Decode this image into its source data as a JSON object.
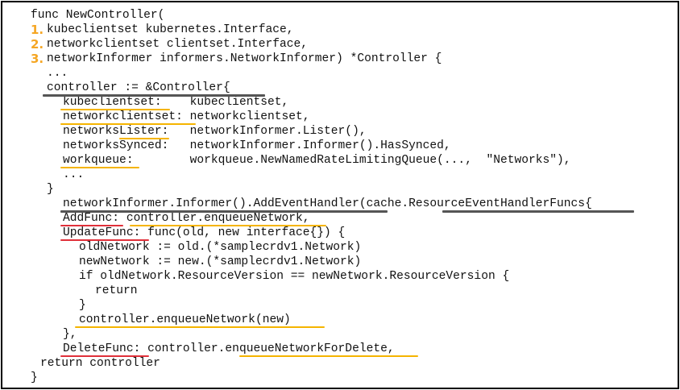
{
  "code_lines": [
    "func NewController(",
    "kubeclientset kubernetes.Interface,",
    "networkclientset clientset.Interface,",
    "networkInformer informers.NetworkInformer) *Controller {",
    "...",
    "controller := &Controller{",
    "kubeclientset:    kubeclientset,",
    "networkclientset: networkclientset,",
    "networksLister:   networkInformer.Lister(),",
    "networksSynced:   networkInformer.Informer().HasSynced,",
    "workqueue:        workqueue.NewNamedRateLimitingQueue(...,  \"Networks\"),",
    "...",
    "}",
    "networkInformer.Informer().AddEventHandler(cache.ResourceEventHandlerFuncs{",
    "AddFunc: controller.enqueueNetwork,",
    "UpdateFunc: func(old, new interface{}) {",
    "oldNetwork := old.(*samplecrdv1.Network)",
    "newNetwork := new.(*samplecrdv1.Network)",
    "if oldNetwork.ResourceVersion == newNetwork.ResourceVersion {",
    "return",
    "}",
    "controller.enqueueNetwork(new)",
    "},",
    "DeleteFunc: controller.enqueueNetworkForDelete,",
    "return controller",
    "}"
  ],
  "markers": [
    "1.",
    "2.",
    "3."
  ],
  "colors": {
    "yellow_highlight": "#f5b400",
    "gray_highlight": "#555555",
    "red_highlight": "#e0303a",
    "marker": "#f5a623"
  }
}
